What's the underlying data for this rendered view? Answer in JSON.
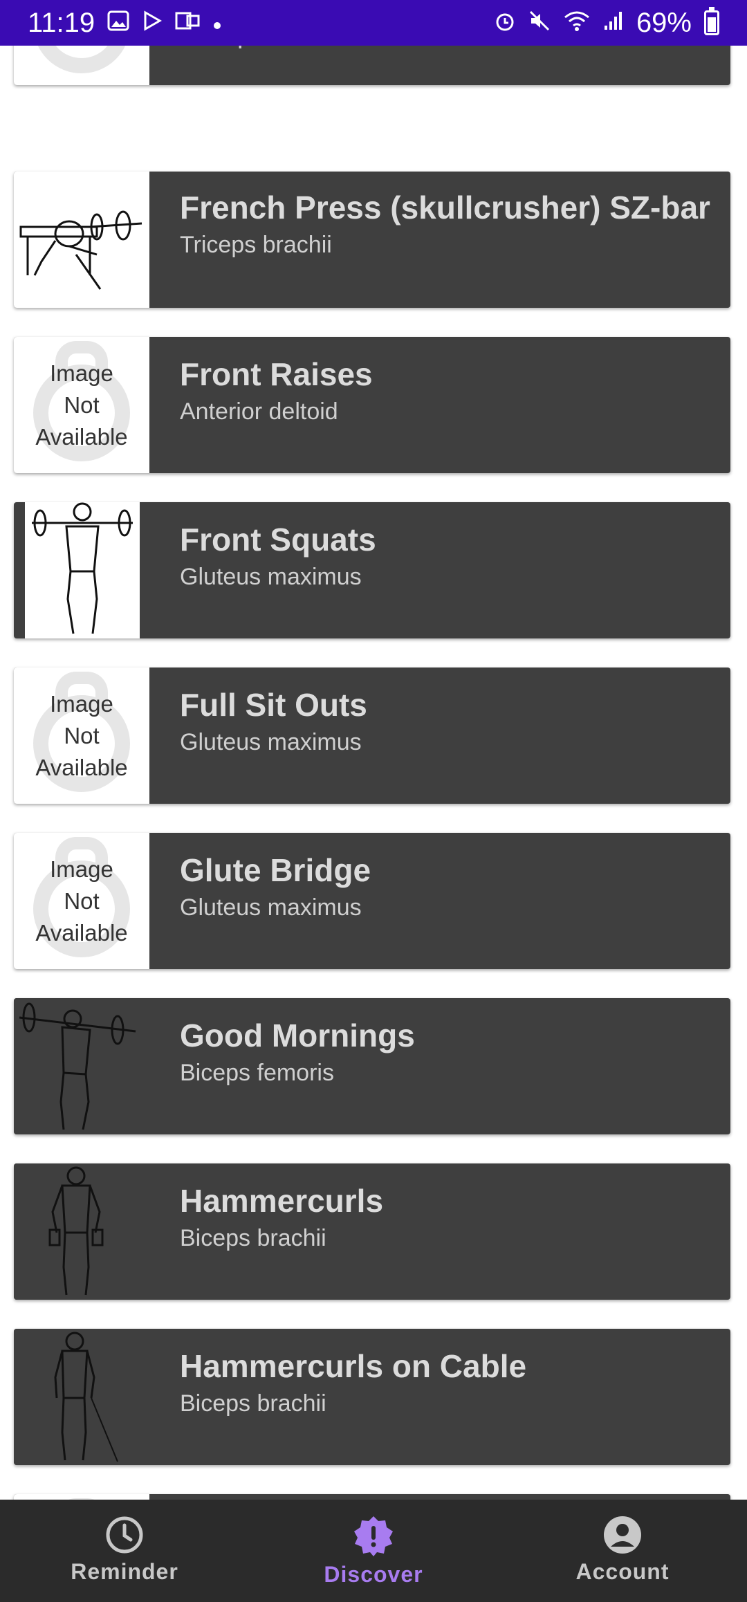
{
  "status_bar": {
    "time": "11:19",
    "battery": "69%"
  },
  "list": {
    "partial_top_subtitle": "Triceps brachii",
    "items": [
      {
        "title": "French Press (skullcrusher) SZ-bar",
        "subtitle": "Triceps brachii",
        "image": "drawing"
      },
      {
        "title": "Front Raises",
        "subtitle": "Anterior deltoid",
        "image": "placeholder"
      },
      {
        "title": "Front Squats",
        "subtitle": "Gluteus maximus",
        "image": "drawing"
      },
      {
        "title": "Full Sit Outs",
        "subtitle": "Gluteus maximus",
        "image": "placeholder"
      },
      {
        "title": "Glute Bridge",
        "subtitle": "Gluteus maximus",
        "image": "placeholder"
      },
      {
        "title": "Good Mornings",
        "subtitle": "Biceps femoris",
        "image": "drawing"
      },
      {
        "title": "Hammercurls",
        "subtitle": "Biceps brachii",
        "image": "drawing"
      },
      {
        "title": "Hammercurls on Cable",
        "subtitle": "Biceps brachii",
        "image": "drawing"
      }
    ],
    "placeholder": {
      "line1": "Image",
      "line2": "Not",
      "line3": "Available"
    }
  },
  "bottom_nav": {
    "items": [
      {
        "label": "Reminder",
        "icon": "clock-icon",
        "active": false
      },
      {
        "label": "Discover",
        "icon": "alert-badge-icon",
        "active": true
      },
      {
        "label": "Account",
        "icon": "account-circle-icon",
        "active": false
      }
    ],
    "active_color": "#a87cf0"
  },
  "colors": {
    "status_bar": "#3a0bb3",
    "card_background": "#3f3f3f",
    "nav_background": "#2b2b2b"
  }
}
